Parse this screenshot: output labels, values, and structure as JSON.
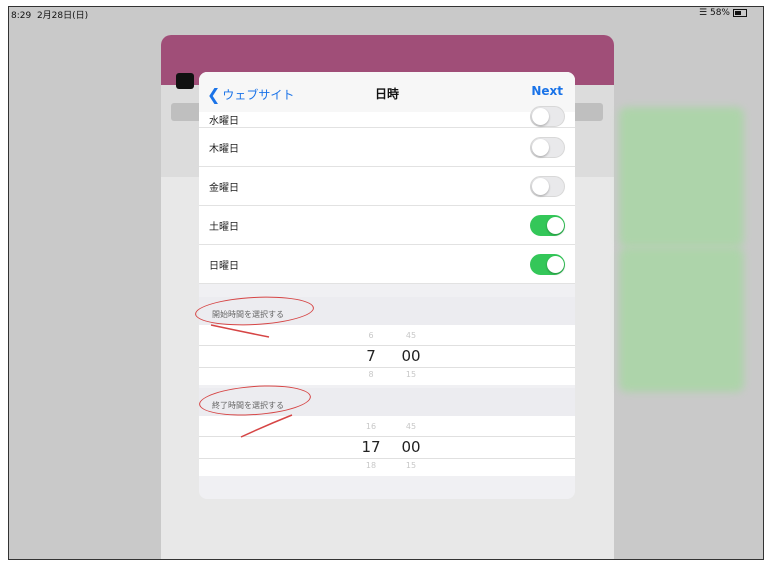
{
  "statusbar": {
    "time": "8:29",
    "date": "2月28日(日)",
    "battery": "58%"
  },
  "navbar": {
    "back_label": "ウェブサイト",
    "title": "日時",
    "next_label": "Next"
  },
  "days": [
    {
      "label": "水曜日",
      "on": false
    },
    {
      "label": "木曜日",
      "on": false
    },
    {
      "label": "金曜日",
      "on": false
    },
    {
      "label": "土曜日",
      "on": true
    },
    {
      "label": "日曜日",
      "on": true
    }
  ],
  "start_section": {
    "header": "開始時間を選択する",
    "hour": {
      "prev": "6",
      "selected": "7",
      "next": "8"
    },
    "minute": {
      "prev": "45",
      "selected": "00",
      "next": "15"
    }
  },
  "end_section": {
    "header": "終了時間を選択する",
    "hour": {
      "prev": "16",
      "selected": "17",
      "next": "18"
    },
    "minute": {
      "prev": "45",
      "selected": "00",
      "next": "15"
    }
  },
  "colors": {
    "accent": "#1a73e8",
    "toggle_on": "#34c759",
    "annotation": "#d64545",
    "header_bg": "#a04e78"
  }
}
